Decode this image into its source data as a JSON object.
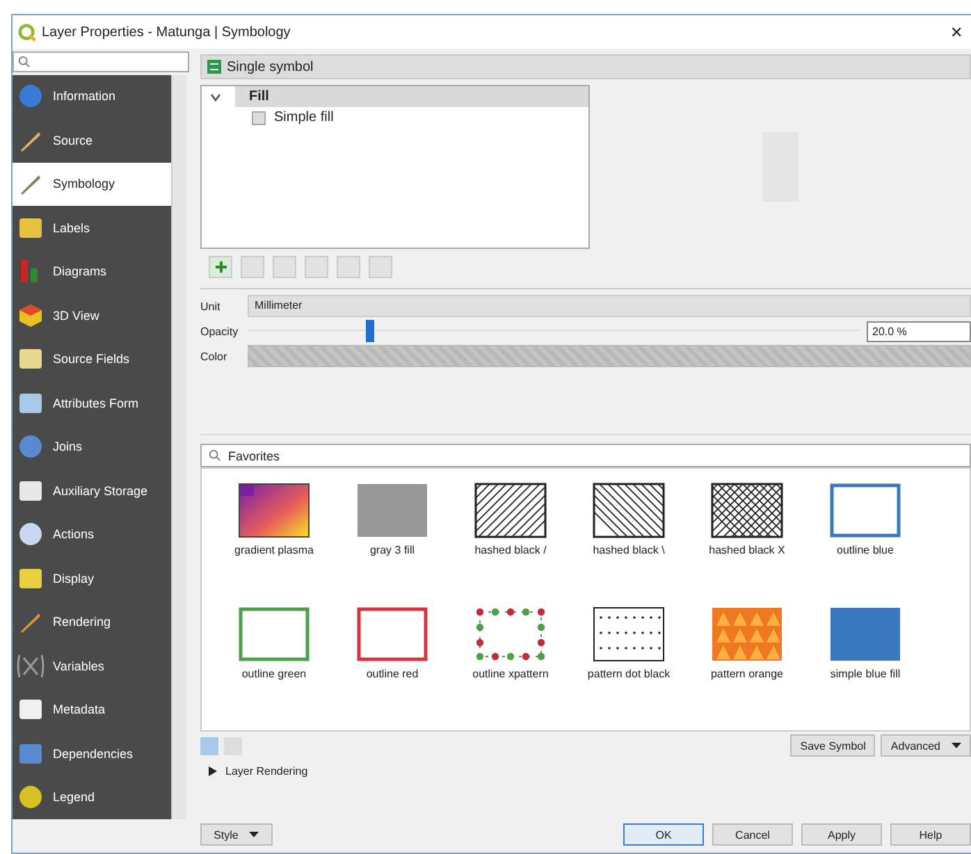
{
  "window": {
    "title": "Layer Properties - Matunga | Symbology",
    "close": "✕"
  },
  "sidebar": {
    "items": [
      {
        "label": "Information",
        "selected": false
      },
      {
        "label": "Source",
        "selected": false
      },
      {
        "label": "Symbology",
        "selected": true
      },
      {
        "label": "Labels",
        "selected": false
      },
      {
        "label": "Diagrams",
        "selected": false
      },
      {
        "label": "3D View",
        "selected": false
      },
      {
        "label": "Source Fields",
        "selected": false
      },
      {
        "label": "Attributes Form",
        "selected": false
      },
      {
        "label": "Joins",
        "selected": false
      },
      {
        "label": "Auxiliary Storage",
        "selected": false
      },
      {
        "label": "Actions",
        "selected": false
      },
      {
        "label": "Display",
        "selected": false
      },
      {
        "label": "Rendering",
        "selected": false
      },
      {
        "label": "Variables",
        "selected": false
      },
      {
        "label": "Metadata",
        "selected": false
      },
      {
        "label": "Dependencies",
        "selected": false
      },
      {
        "label": "Legend",
        "selected": false
      }
    ]
  },
  "renderer": {
    "value": "Single symbol"
  },
  "symbol_tree": [
    {
      "label": "Fill",
      "expanded": true,
      "selected": true,
      "children": [
        {
          "label": "Simple fill",
          "selected": false
        }
      ]
    }
  ],
  "unit": {
    "label": "Unit",
    "value": "Millimeter"
  },
  "opacity": {
    "label": "Opacity",
    "level": 0.2,
    "reading": "20.0 %"
  },
  "color": {
    "label": "Color"
  },
  "library": {
    "filter": "Favorites",
    "swatches": [
      {
        "label": "gradient plasma",
        "kind": "gradient",
        "color": "#7a1fa2"
      },
      {
        "label": "gray 3 fill",
        "kind": "solid",
        "color": "#999999"
      },
      {
        "label": "hashed black /",
        "kind": "hatch-forward",
        "color": "#222222"
      },
      {
        "label": "hashed black \\",
        "kind": "hatch-back",
        "color": "#222222"
      },
      {
        "label": "hashed black X",
        "kind": "crosshatch",
        "color": "#222222"
      },
      {
        "label": "outline blue",
        "kind": "outline",
        "color": "#3a78c0"
      },
      {
        "label": "outline green",
        "kind": "outline",
        "color": "#4ca049"
      },
      {
        "label": "outline red",
        "kind": "outline",
        "color": "#d8323c"
      },
      {
        "label": "outline xpattern",
        "kind": "dotted-outline",
        "color": "#c8283c"
      },
      {
        "label": "pattern dot black",
        "kind": "dots",
        "color": "#222222"
      },
      {
        "label": "pattern orange",
        "kind": "triangles",
        "color": "#f07820"
      },
      {
        "label": "simple blue fill",
        "kind": "solid",
        "color": "#3a78c0"
      }
    ]
  },
  "library_buttons": [
    "Save Symbol",
    "Advanced"
  ],
  "layer_rendering": {
    "label": "Layer Rendering",
    "expanded": false
  },
  "style_button": "Style",
  "buttons": [
    {
      "label": "OK",
      "selected": true
    },
    {
      "label": "Cancel",
      "selected": false
    },
    {
      "label": "Apply",
      "selected": false
    },
    {
      "label": "Help",
      "selected": false
    }
  ]
}
